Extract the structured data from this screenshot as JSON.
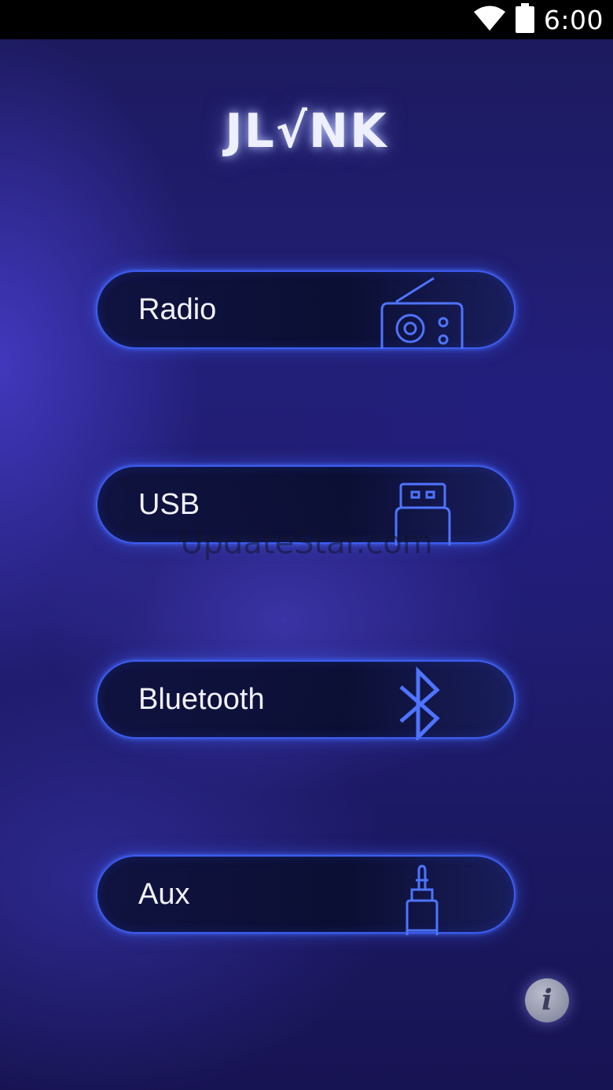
{
  "status_bar": {
    "time": "6:00",
    "icons": [
      "wifi-icon",
      "battery-icon"
    ]
  },
  "app": {
    "logo_text": "JL√NK"
  },
  "menu": {
    "items": [
      {
        "label": "Radio",
        "icon": "radio-icon"
      },
      {
        "label": "USB",
        "icon": "usb-icon"
      },
      {
        "label": "Bluetooth",
        "icon": "bluetooth-icon"
      },
      {
        "label": "Aux",
        "icon": "aux-jack-icon"
      }
    ]
  },
  "watermark": "UpdateStar.com",
  "info_button": {
    "glyph": "i",
    "icon": "info-icon"
  },
  "colors": {
    "accent_border": "#3c5cf2",
    "icon_stroke": "#4e74ff",
    "text": "#f1f2ff"
  }
}
